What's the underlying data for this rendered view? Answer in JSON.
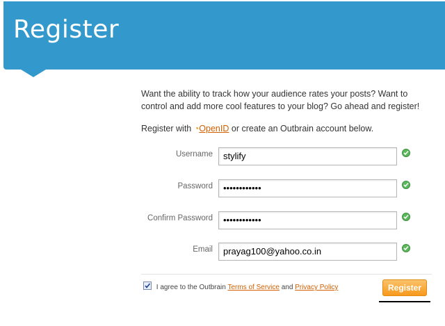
{
  "header": {
    "title": "Register"
  },
  "intro": {
    "text": "Want the ability to track how your audience rates your posts? Want to control and add more cool features to your blog? Go ahead and register!"
  },
  "openid": {
    "prefix": "Register with",
    "logo_glyph": "◔",
    "link_label": "OpenID",
    "suffix": "or create an Outbrain account below."
  },
  "form": {
    "username": {
      "label": "Username",
      "value": "stylify"
    },
    "password": {
      "label": "Password",
      "value": "••••••••••••"
    },
    "confirm_password": {
      "label": "Confirm Password",
      "value": "••••••••••••"
    },
    "email": {
      "label": "Email",
      "value": "prayag100@yahoo.co.in"
    }
  },
  "agreement": {
    "prefix": "I agree to the Outbrain",
    "terms_label": "Terms of Service",
    "and": "and",
    "privacy_label": "Privacy Policy",
    "checked": true
  },
  "register_button": {
    "label": "Register"
  },
  "colors": {
    "header": "#3399cc",
    "link": "#d35f00",
    "button": "#f7991c",
    "check": "#5cb85c"
  }
}
